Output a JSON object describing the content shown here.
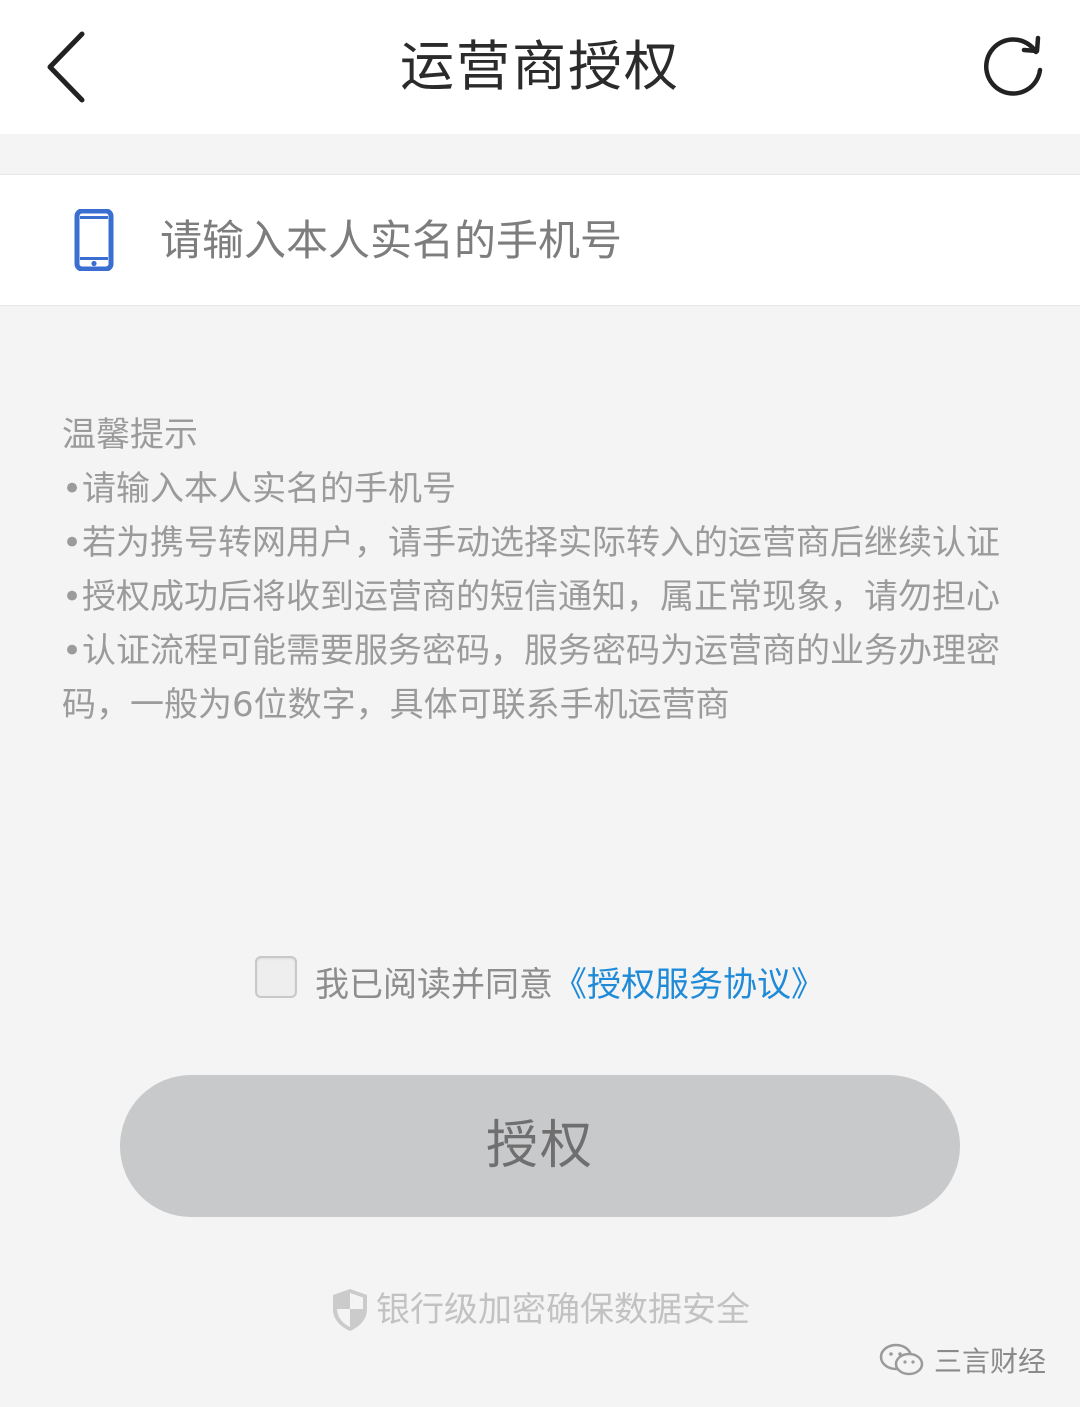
{
  "header": {
    "title": "运营商授权"
  },
  "phone": {
    "placeholder": "请输入本人实名的手机号"
  },
  "tips": {
    "title": "温馨提示",
    "items": [
      "•请输入本人实名的手机号",
      "•若为携号转网用户，请手动选择实际转入的运营商后继续认证",
      "•授权成功后将收到运营商的短信通知，属正常现象，请勿担心",
      "•认证流程可能需要服务密码，服务密码为运营商的业务办理密码，一般为6位数字，具体可联系手机运营商"
    ]
  },
  "agreement": {
    "prefix": "我已阅读并同意",
    "link": "《授权服务协议》"
  },
  "auth_button": {
    "label": "授权"
  },
  "security": {
    "text": "银行级加密确保数据安全"
  },
  "watermark": {
    "text": "三言财经"
  },
  "colors": {
    "link": "#1f8bd8",
    "phone_icon": "#3a6fd1",
    "button_bg": "#c8c9cb"
  },
  "icons": {
    "back": "chevron-left-icon",
    "refresh": "refresh-icon",
    "phone": "mobile-phone-icon",
    "shield": "shield-icon"
  }
}
